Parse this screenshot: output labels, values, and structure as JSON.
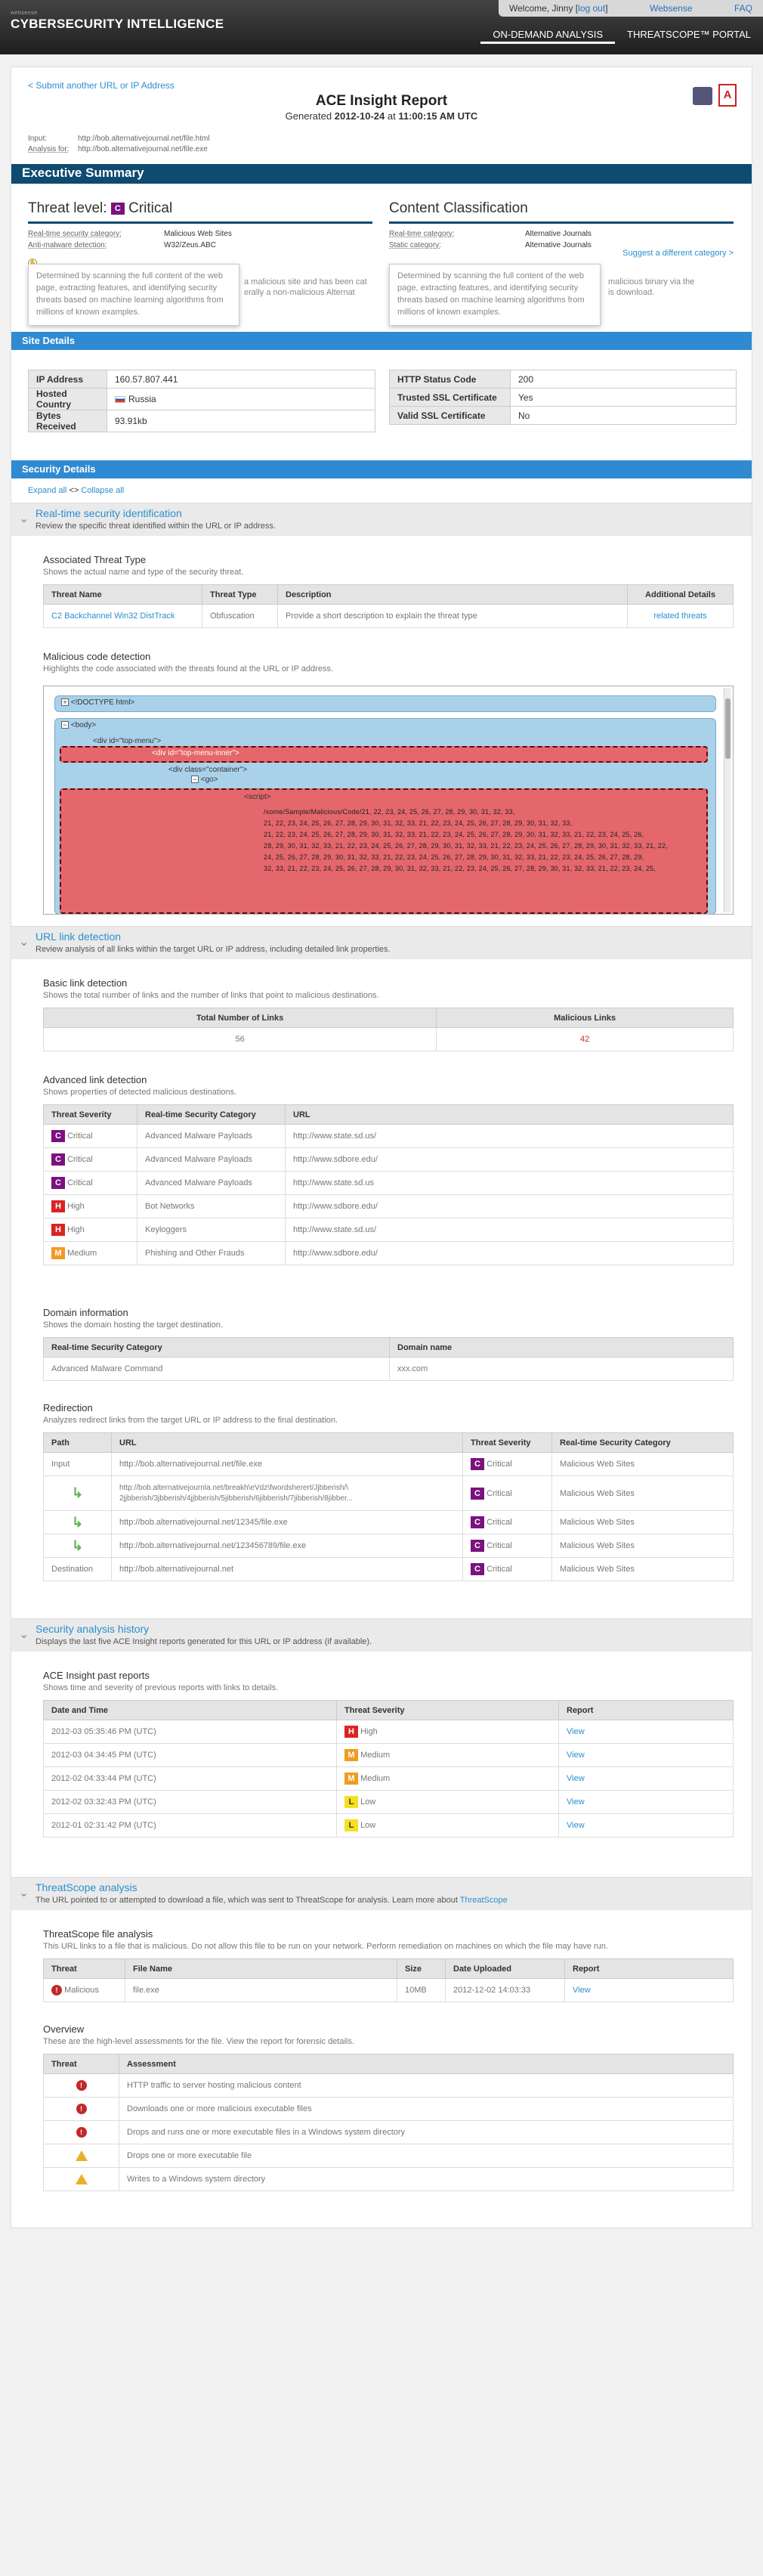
{
  "header": {
    "brand_small": "websense",
    "brand": "CYBERSECURITY INTELLIGENCE",
    "welcome": "Welcome, Jinny [",
    "logout": "log out",
    "welcome_end": "]",
    "websense_link": "Websense",
    "faq": "FAQ",
    "nav": [
      "ON-DEMAND ANALYSIS",
      "THREATSCOPE™ PORTAL"
    ]
  },
  "report": {
    "submit": "< Submit another URL or IP Address",
    "title": "ACE Insight Report",
    "generated_label": "Generated",
    "generated_date": "2012-10-24",
    "generated_at": "at",
    "generated_time": "11:00:15 AM UTC",
    "input_label": "Input:",
    "input_value": "http://bob.alternativejournal.net/file.html",
    "analysis_label": "Analysis for:",
    "analysis_value": "http://bob.alternativejournal.net/file.exe",
    "pdf": "A"
  },
  "exec": {
    "title": "Executive Summary",
    "threat_prefix": "Threat level:",
    "threat_badge": "C",
    "threat_level": "Critical",
    "rt_label": "Real-time security category:",
    "rt_value": "Malicious Web Sites",
    "am_label": "Anti-malware detection:",
    "am_value": "W32/Zeus.ABC",
    "tooltip": "Determined by scanning the full content of the web page, extracting features, and identifying security threats based on machine learning algorithms from millions of known examples.",
    "body_frag1": "a malicious site and has been cat",
    "body_frag2": "erally a non-malicious Alternat",
    "content_title": "Content Classification",
    "cc_rt_label": "Real-time category:",
    "cc_rt_value": "Alternative Journals",
    "cc_st_label": "Static category:",
    "cc_st_value": "Alternative Journals",
    "suggest": "Suggest a different category >",
    "body_frag3": "malicious binary via the",
    "body_frag4": "is download."
  },
  "site": {
    "title": "Site Details",
    "left": [
      {
        "k": "IP Address",
        "v": "160.57.807.441"
      },
      {
        "k": "Hosted Country",
        "v": "Russia"
      },
      {
        "k": "Bytes Received",
        "v": "93.91kb"
      }
    ],
    "right": [
      {
        "k": "HTTP Status Code",
        "v": "200"
      },
      {
        "k": "Trusted SSL Certificate",
        "v": "Yes"
      },
      {
        "k": "Valid SSL Certificate",
        "v": "No"
      }
    ]
  },
  "security": {
    "title": "Security Details",
    "expand": "Expand all",
    "sep": "<>",
    "collapse": "Collapse all"
  },
  "rt": {
    "title": "Real-time security identification",
    "desc": "Review the specific threat identified within the URL or IP address.",
    "assoc_title": "Associated Threat Type",
    "assoc_desc": "Shows the actual name and type of the security threat.",
    "cols": [
      "Threat Name",
      "Threat Type",
      "Description",
      "Additional Details"
    ],
    "row": [
      "C2 Backchannel Win32 DistTrack",
      "Obfuscation",
      "Provide a short description to explain the threat type",
      "related threats"
    ],
    "code_title": "Malicious code detection",
    "code_desc": "Highlights the code associated with the threats found at the URL or IP address.",
    "doctype": "<!DOCTYPE html>",
    "body": "<body>",
    "div1": "<div id=\"top-menu\">",
    "div2": "<div id=\"top-menu-inner\">",
    "div3": "<div class=\"container\">",
    "go": "<go>",
    "script": "<script>",
    "code_lines": [
      "/some/Sample/Malicious/Code/21, 22, 23, 24, 25, 26, 27, 28, 29, 30, 31, 32, 33,",
      "21, 22, 23, 24, 25, 26, 27, 28, 29, 30, 31, 32, 33, 21, 22, 23, 24, 25, 26, 27, 28, 29, 30, 31, 32, 33,",
      "21, 22, 23, 24, 25, 26, 27, 28, 29, 30, 31, 32, 33, 21, 22, 23, 24, 25, 26, 27, 28, 29, 30, 31, 32, 33, 21, 22, 23, 24, 25, 26,",
      "28, 29, 30, 31, 32, 33, 21, 22, 23, 24, 25, 26, 27, 28, 29, 30, 31, 32, 33, 21, 22, 23, 24, 25, 26, 27, 28, 29, 30, 31, 32, 33, 21, 22,",
      "24, 25, 26, 27, 28, 29, 30, 31, 32, 33, 21, 22, 23, 24, 25, 26, 27, 28, 29, 30, 31, 32, 33, 21, 22, 23, 24, 25, 26, 27, 28, 29,",
      "32, 33, 21, 22, 23, 24, 25, 26, 27, 28, 29, 30, 31, 32, 33, 21, 22, 23, 24, 25, 26, 27, 28, 29, 30, 31, 32, 33, 21, 22, 23, 24, 25,"
    ]
  },
  "url": {
    "title": "URL link detection",
    "desc": "Review analysis of all links within the target URL or IP address, including detailed link properties.",
    "basic_title": "Basic link detection",
    "basic_desc": "Shows the total number of links and the number of links that point to malicious destinations.",
    "basic_cols": [
      "Total Number of Links",
      "Malicious Links"
    ],
    "total": "56",
    "malicious": "42",
    "adv_title": "Advanced link detection",
    "adv_desc": "Shows properties of detected malicious destinations.",
    "adv_cols": [
      "Threat Severity",
      "Real-time Security Category",
      "URL"
    ],
    "adv_rows": [
      {
        "b": "C",
        "sev": "Critical",
        "cat": "Advanced Malware Payloads",
        "url": "http://www.state.sd.us/"
      },
      {
        "b": "C",
        "sev": "Critical",
        "cat": "Advanced Malware Payloads",
        "url": "http://www.sdbore.edu/"
      },
      {
        "b": "C",
        "sev": "Critical",
        "cat": "Advanced Malware Payloads",
        "url": "http://www.state.sd.us"
      },
      {
        "b": "H",
        "sev": "High",
        "cat": "Bot Networks",
        "url": "http://www.sdbore.edu/"
      },
      {
        "b": "H",
        "sev": "High",
        "cat": "Keyloggers",
        "url": "http://www.state.sd.us/"
      },
      {
        "b": "M",
        "sev": "Medium",
        "cat": "Phishing and Other Frauds",
        "url": "http://www.sdbore.edu/"
      }
    ],
    "dom_title": "Domain information",
    "dom_desc": "Shows the domain hosting the target destination.",
    "dom_cols": [
      "Real-time Security Category",
      "Domain name"
    ],
    "dom_row": [
      "Advanced Malware Command",
      "xxx.com"
    ],
    "red_title": "Redirection",
    "red_desc": "Analyzes redirect links from the target URL or IP address to the final destination.",
    "red_cols": [
      "Path",
      "URL",
      "Threat Severity",
      "Real-time Security Category"
    ],
    "red_rows": [
      {
        "path": "Input",
        "url": "http://bob.alternativejournal.net/file.exe",
        "b": "C",
        "sev": "Critical",
        "cat": "Malicious Web Sites"
      },
      {
        "path": "",
        "url": "http://bob.alternativejournla.net/breakh\\eVdz\\fwordsherert/Jjbberish/\\ 2jjbberish/3jbberish/4jjbberish/5jibberish/6jibberish/7jibberish/8jibber...",
        "b": "C",
        "sev": "Critical",
        "cat": "Malicious Web Sites"
      },
      {
        "path": "",
        "url": "http://bob.alternativejournal.net/12345/file.exe",
        "b": "C",
        "sev": "Critical",
        "cat": "Malicious Web Sites"
      },
      {
        "path": "",
        "url": "http://bob.alternativejournal.net/123456789/file.exe",
        "b": "C",
        "sev": "Critical",
        "cat": "Malicious Web Sites"
      },
      {
        "path": "Destination",
        "url": "http://bob.alternativejournal.net",
        "b": "C",
        "sev": "Critical",
        "cat": "Malicious Web Sites"
      }
    ]
  },
  "history": {
    "title": "Security analysis history",
    "desc": "Displays the last five ACE Insight reports generated for this URL or IP address (if available).",
    "sub_title": "ACE Insight past reports",
    "sub_desc": "Shows time and severity of previous reports with links to details.",
    "cols": [
      "Date and Time",
      "Threat Severity",
      "Report"
    ],
    "rows": [
      {
        "dt": "2012-03 05:35:46 PM (UTC)",
        "b": "H",
        "sev": "High",
        "rep": "View"
      },
      {
        "dt": "2012-03 04:34:45 PM (UTC)",
        "b": "M",
        "sev": "Medium",
        "rep": "View"
      },
      {
        "dt": "2012-02 04:33:44 PM (UTC)",
        "b": "M",
        "sev": "Medium",
        "rep": "View"
      },
      {
        "dt": "2012-02 03:32:43 PM (UTC)",
        "b": "L",
        "sev": "Low",
        "rep": "View"
      },
      {
        "dt": "2012-01 02:31:42 PM (UTC)",
        "b": "L",
        "sev": "Low",
        "rep": "View"
      }
    ]
  },
  "ts": {
    "title": "ThreatScope analysis",
    "desc": "The URL pointed to or attempted to download a file, which was sent to ThreatScope for analysis. Learn more about",
    "desc_link": "ThreatScope",
    "file_title": "ThreatScope file analysis",
    "file_desc": "This URL links to a file that is malicious. Do not allow this file to be run on your network. Perform remediation on machines on which the file may have run.",
    "file_cols": [
      "Threat",
      "File Name",
      "Size",
      "Date Uploaded",
      "Report"
    ],
    "file_row": {
      "threat": "Malicious",
      "name": "file.exe",
      "size": "10MB",
      "date": "2012-12-02 14:03:33",
      "report": "View"
    },
    "ov_title": "Overview",
    "ov_desc": "These are the high-level assessments for the file. View the report for forensic details.",
    "ov_cols": [
      "Threat",
      "Assessment"
    ],
    "ov_rows": [
      {
        "icon": "stop",
        "text": "HTTP traffic to server hosting malicious content"
      },
      {
        "icon": "stop",
        "text": "Downloads one or more malicious executable files"
      },
      {
        "icon": "stop",
        "text": "Drops and runs one or more executable files in a Windows system directory"
      },
      {
        "icon": "warn",
        "text": "Drops one or more executable file"
      },
      {
        "icon": "warn",
        "text": "Writes to a Windows system directory"
      }
    ]
  }
}
